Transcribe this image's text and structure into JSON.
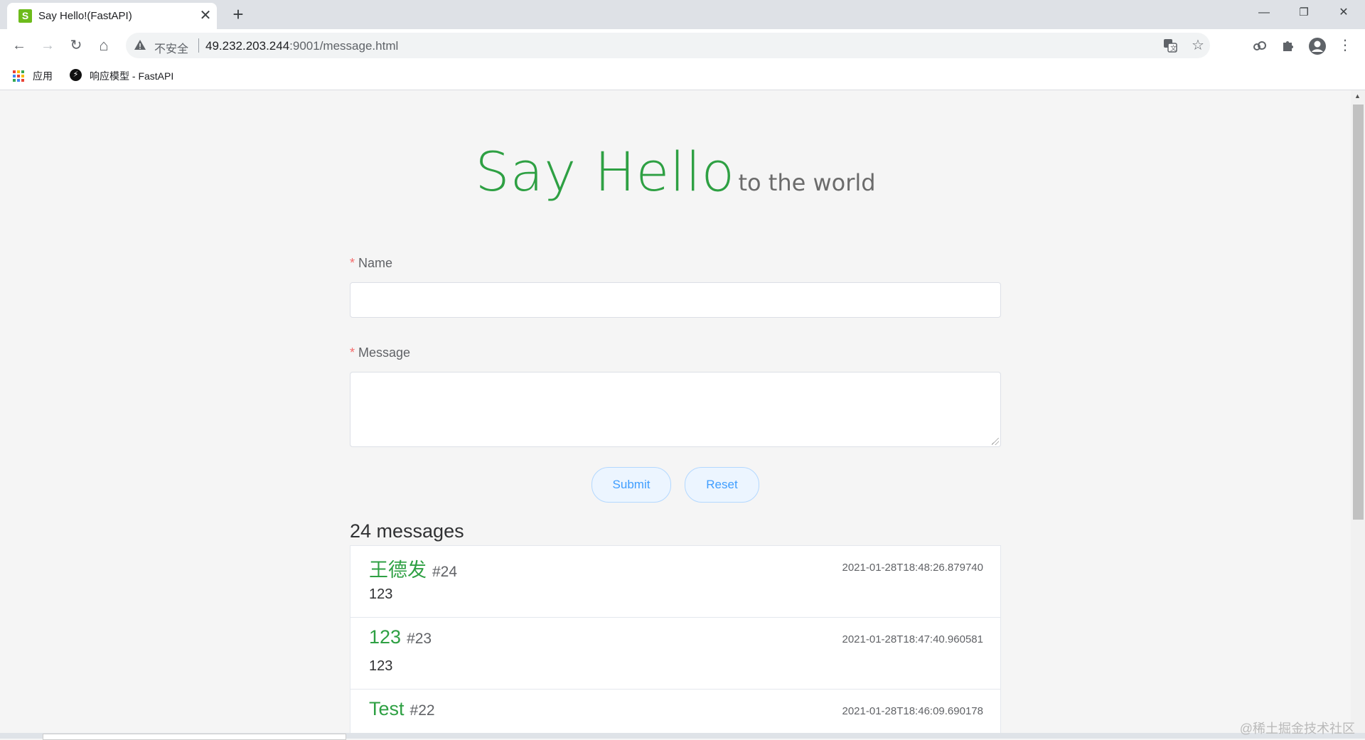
{
  "browser": {
    "tab_title": "Say Hello!(FastAPI)",
    "tab_favicon": "S",
    "close_tab_glyph": "✕",
    "new_tab_glyph": "+",
    "window_controls": {
      "minimize": "—",
      "restore": "❐",
      "close": "✕"
    },
    "nav": {
      "back": "←",
      "forward": "→",
      "reload": "↻",
      "home": "⌂"
    },
    "omnibox": {
      "security_text": "不安全",
      "url_host": "49.232.203.244",
      "url_rest": ":9001/message.html"
    },
    "bookmarks": {
      "apps_label": "应用",
      "fastapi_label": "响应模型 - FastAPI"
    }
  },
  "page": {
    "hero_title": "Say Hello",
    "hero_subtitle": "to the world",
    "form": {
      "name_label": "Name",
      "message_label": "Message",
      "required_mark": "*",
      "submit_label": "Submit",
      "reset_label": "Reset",
      "name_value": "",
      "message_value": ""
    },
    "messages_count": "24 messages",
    "messages": [
      {
        "name": "王德发",
        "number": "#24",
        "time": "2021-01-28T18:48:26.879740",
        "body": "123"
      },
      {
        "name": "123",
        "number": "#23",
        "time": "2021-01-28T18:47:40.960581",
        "body": "123"
      },
      {
        "name": "Test",
        "number": "#22",
        "time": "2021-01-28T18:46:09.690178",
        "body": ""
      }
    ]
  },
  "watermark": "@稀土掘金技术社区",
  "colors": {
    "accent_green": "#2ea043",
    "button_blue": "#409eff",
    "required_red": "#f56c6c"
  }
}
